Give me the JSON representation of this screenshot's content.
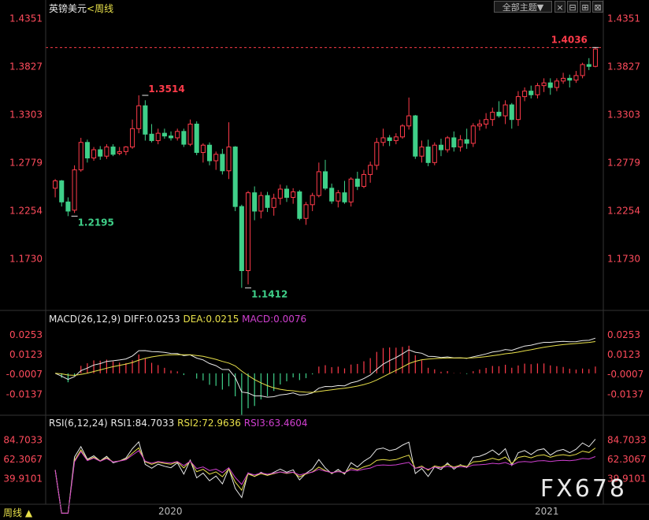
{
  "header": {
    "symbol": "英镑美元",
    "period_prefix": "<",
    "period": "周线",
    "view_selector": "全部主题",
    "view_selector_arrow": "▼",
    "btn_close": "×",
    "btn_minimize": "⊟",
    "btn_maximize": "⊞",
    "btn_restore": "⊠"
  },
  "footer": {
    "period_button": "周线",
    "period_arrow": "▲",
    "x_labels": [
      "2020",
      "2021"
    ]
  },
  "watermark": "FX678",
  "colors": {
    "up": "#ff3b4a",
    "down": "#3fd089",
    "price_axis": "#ff4b5c",
    "white": "#e8e8e8",
    "yellow": "#e8e04a",
    "magenta": "#d040d0",
    "grid": "#333333"
  },
  "chart_data": [
    {
      "type": "candlestick",
      "title": "英镑美元",
      "y_ticks": [
        "1.4351",
        "1.3827",
        "1.3303",
        "1.2779",
        "1.2254",
        "1.1730"
      ],
      "ylim": [
        1.12,
        1.44
      ],
      "last_price_line": 1.4036,
      "annotations": [
        {
          "label": "1.3514",
          "value": 1.3514,
          "bar": 14
        },
        {
          "label": "1.2195",
          "value": 1.2195,
          "bar": 3
        },
        {
          "label": "1.1412",
          "value": 1.1412,
          "bar": 30
        },
        {
          "label": "1.4036",
          "value": 1.4036,
          "bar": 84
        }
      ],
      "ohlc": [
        [
          1.25,
          1.26,
          1.24,
          1.258
        ],
        [
          1.258,
          1.259,
          1.23,
          1.235
        ],
        [
          1.235,
          1.24,
          1.2195,
          1.225
        ],
        [
          1.226,
          1.275,
          1.223,
          1.27
        ],
        [
          1.27,
          1.305,
          1.268,
          1.3
        ],
        [
          1.3,
          1.303,
          1.278,
          1.283
        ],
        [
          1.283,
          1.295,
          1.28,
          1.292
        ],
        [
          1.292,
          1.296,
          1.281,
          1.285
        ],
        [
          1.285,
          1.298,
          1.282,
          1.295
        ],
        [
          1.295,
          1.298,
          1.285,
          1.287
        ],
        [
          1.288,
          1.295,
          1.286,
          1.29
        ],
        [
          1.29,
          1.296,
          1.286,
          1.295
        ],
        [
          1.295,
          1.325,
          1.293,
          1.315
        ],
        [
          1.315,
          1.3514,
          1.31,
          1.34
        ],
        [
          1.34,
          1.346,
          1.302,
          1.309
        ],
        [
          1.309,
          1.32,
          1.3,
          1.302
        ],
        [
          1.302,
          1.315,
          1.298,
          1.31
        ],
        [
          1.31,
          1.315,
          1.304,
          1.307
        ],
        [
          1.307,
          1.312,
          1.302,
          1.305
        ],
        [
          1.305,
          1.315,
          1.302,
          1.312
        ],
        [
          1.312,
          1.315,
          1.295,
          1.298
        ],
        [
          1.298,
          1.325,
          1.296,
          1.32
        ],
        [
          1.32,
          1.323,
          1.286,
          1.289
        ],
        [
          1.289,
          1.299,
          1.278,
          1.297
        ],
        [
          1.297,
          1.3,
          1.275,
          1.28
        ],
        [
          1.28,
          1.29,
          1.27,
          1.287
        ],
        [
          1.287,
          1.293,
          1.265,
          1.269
        ],
        [
          1.269,
          1.322,
          1.26,
          1.295
        ],
        [
          1.295,
          1.296,
          1.225,
          1.23
        ],
        [
          1.23,
          1.232,
          1.1412,
          1.16
        ],
        [
          1.16,
          1.247,
          1.145,
          1.245
        ],
        [
          1.245,
          1.252,
          1.215,
          1.225
        ],
        [
          1.225,
          1.246,
          1.217,
          1.242
        ],
        [
          1.242,
          1.246,
          1.224,
          1.229
        ],
        [
          1.229,
          1.244,
          1.22,
          1.239
        ],
        [
          1.239,
          1.254,
          1.232,
          1.249
        ],
        [
          1.249,
          1.253,
          1.235,
          1.24
        ],
        [
          1.24,
          1.25,
          1.233,
          1.246
        ],
        [
          1.246,
          1.248,
          1.215,
          1.217
        ],
        [
          1.217,
          1.235,
          1.21,
          1.232
        ],
        [
          1.232,
          1.245,
          1.225,
          1.242
        ],
        [
          1.242,
          1.278,
          1.24,
          1.268
        ],
        [
          1.268,
          1.281,
          1.248,
          1.25
        ],
        [
          1.25,
          1.255,
          1.233,
          1.236
        ],
        [
          1.236,
          1.248,
          1.229,
          1.245
        ],
        [
          1.245,
          1.258,
          1.233,
          1.235
        ],
        [
          1.235,
          1.262,
          1.23,
          1.26
        ],
        [
          1.26,
          1.268,
          1.248,
          1.252
        ],
        [
          1.252,
          1.27,
          1.25,
          1.265
        ],
        [
          1.265,
          1.279,
          1.256,
          1.275
        ],
        [
          1.275,
          1.305,
          1.27,
          1.3
        ],
        [
          1.3,
          1.315,
          1.296,
          1.305
        ],
        [
          1.305,
          1.308,
          1.296,
          1.302
        ],
        [
          1.302,
          1.31,
          1.298,
          1.306
        ],
        [
          1.306,
          1.32,
          1.304,
          1.318
        ],
        [
          1.318,
          1.349,
          1.314,
          1.329
        ],
        [
          1.329,
          1.33,
          1.282,
          1.285
        ],
        [
          1.285,
          1.302,
          1.278,
          1.295
        ],
        [
          1.295,
          1.303,
          1.274,
          1.278
        ],
        [
          1.278,
          1.3,
          1.275,
          1.297
        ],
        [
          1.297,
          1.304,
          1.285,
          1.292
        ],
        [
          1.292,
          1.307,
          1.289,
          1.305
        ],
        [
          1.305,
          1.312,
          1.29,
          1.295
        ],
        [
          1.295,
          1.308,
          1.29,
          1.303
        ],
        [
          1.303,
          1.315,
          1.293,
          1.299
        ],
        [
          1.299,
          1.321,
          1.295,
          1.318
        ],
        [
          1.318,
          1.325,
          1.313,
          1.32
        ],
        [
          1.32,
          1.332,
          1.315,
          1.325
        ],
        [
          1.325,
          1.338,
          1.318,
          1.333
        ],
        [
          1.333,
          1.345,
          1.327,
          1.329
        ],
        [
          1.329,
          1.346,
          1.32,
          1.341
        ],
        [
          1.341,
          1.343,
          1.315,
          1.325
        ],
        [
          1.325,
          1.356,
          1.318,
          1.35
        ],
        [
          1.35,
          1.36,
          1.345,
          1.356
        ],
        [
          1.356,
          1.362,
          1.348,
          1.352
        ],
        [
          1.352,
          1.365,
          1.348,
          1.362
        ],
        [
          1.362,
          1.37,
          1.355,
          1.365
        ],
        [
          1.365,
          1.37,
          1.352,
          1.36
        ],
        [
          1.36,
          1.37,
          1.356,
          1.367
        ],
        [
          1.367,
          1.376,
          1.364,
          1.37
        ],
        [
          1.37,
          1.374,
          1.36,
          1.368
        ],
        [
          1.368,
          1.378,
          1.365,
          1.373
        ],
        [
          1.373,
          1.387,
          1.37,
          1.385
        ],
        [
          1.385,
          1.392,
          1.379,
          1.383
        ],
        [
          1.383,
          1.4036,
          1.382,
          1.402
        ]
      ]
    },
    {
      "type": "macd",
      "title": "MACD(26,12,9)",
      "diff_label": "DIFF:0.0253",
      "dea_label": "DEA:0.0215",
      "macd_label": "MACD:0.0076",
      "y_ticks": [
        "0.0253",
        "0.0123",
        "-0.0007",
        "-0.0137"
      ],
      "ylim": [
        -0.026,
        0.031
      ]
    },
    {
      "type": "rsi",
      "title": "RSI(6,12,24)",
      "rsi1_label": "RSI1:84.7033",
      "rsi2_label": "RSI2:72.9636",
      "rsi3_label": "RSI3:63.4604",
      "y_ticks": [
        "84.7033",
        "62.3067",
        "39.9101"
      ],
      "ylim": [
        14,
        96
      ]
    }
  ]
}
